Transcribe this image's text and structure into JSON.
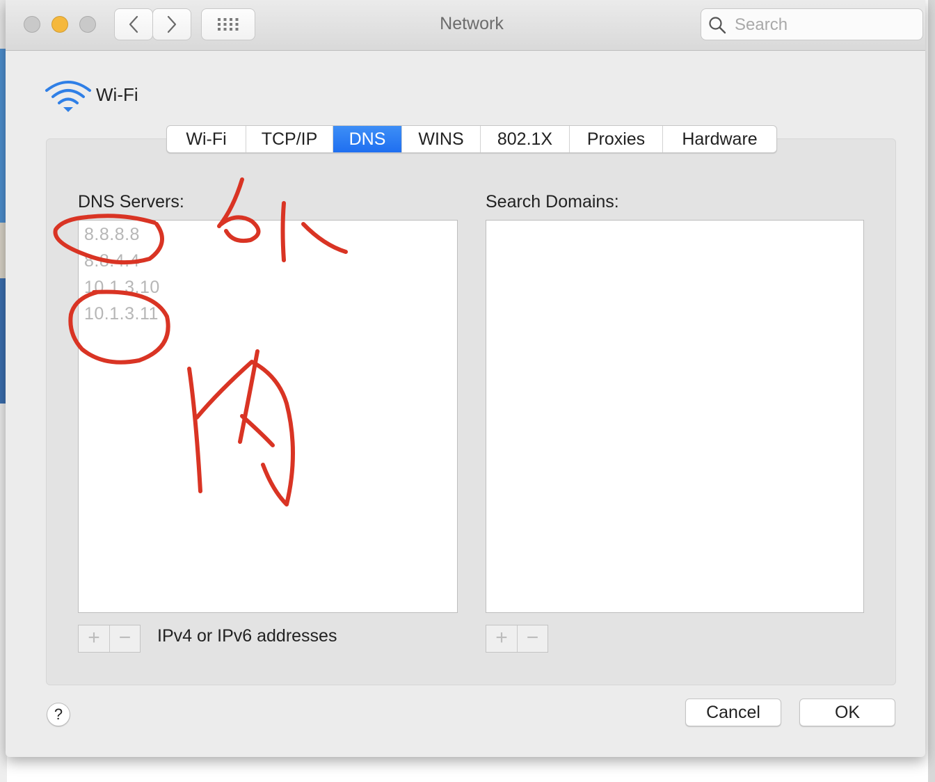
{
  "window": {
    "title": "Network",
    "traffic_lights": {
      "close": "#c9c9c9",
      "minimize": "#f5b83d",
      "zoom": "#c9c9c9"
    },
    "nav": {
      "back_icon": "chevron-left-icon",
      "forward_icon": "chevron-right-icon",
      "grid_icon": "grid-icon"
    },
    "search": {
      "placeholder": "Search",
      "value": ""
    }
  },
  "interface": {
    "name": "Wi-Fi",
    "icon": "wifi-icon",
    "icon_color": "#2f7fe6"
  },
  "tabs": [
    {
      "label": "Wi-Fi",
      "active": false
    },
    {
      "label": "TCP/IP",
      "active": false
    },
    {
      "label": "DNS",
      "active": true
    },
    {
      "label": "WINS",
      "active": false
    },
    {
      "label": "802.1X",
      "active": false
    },
    {
      "label": "Proxies",
      "active": false
    },
    {
      "label": "Hardware",
      "active": false
    }
  ],
  "dns": {
    "servers_label": "DNS Servers:",
    "servers": [
      "8.8.8.8",
      "8.8.4.4",
      "10.1.3.10",
      "10.1.3.11"
    ],
    "hint": "IPv4 or IPv6 addresses",
    "search_domains_label": "Search Domains:",
    "search_domains": [],
    "add_symbol": "+",
    "remove_symbol": "−"
  },
  "footer": {
    "help_symbol": "?",
    "cancel_label": "Cancel",
    "ok_label": "OK"
  },
  "annotation": {
    "color": "#d93424",
    "marks": [
      "circle-around-8.8.8.8",
      "handwritten-outside-character",
      "circle-around-10.1.3.11",
      "handwritten-inside-character"
    ]
  }
}
